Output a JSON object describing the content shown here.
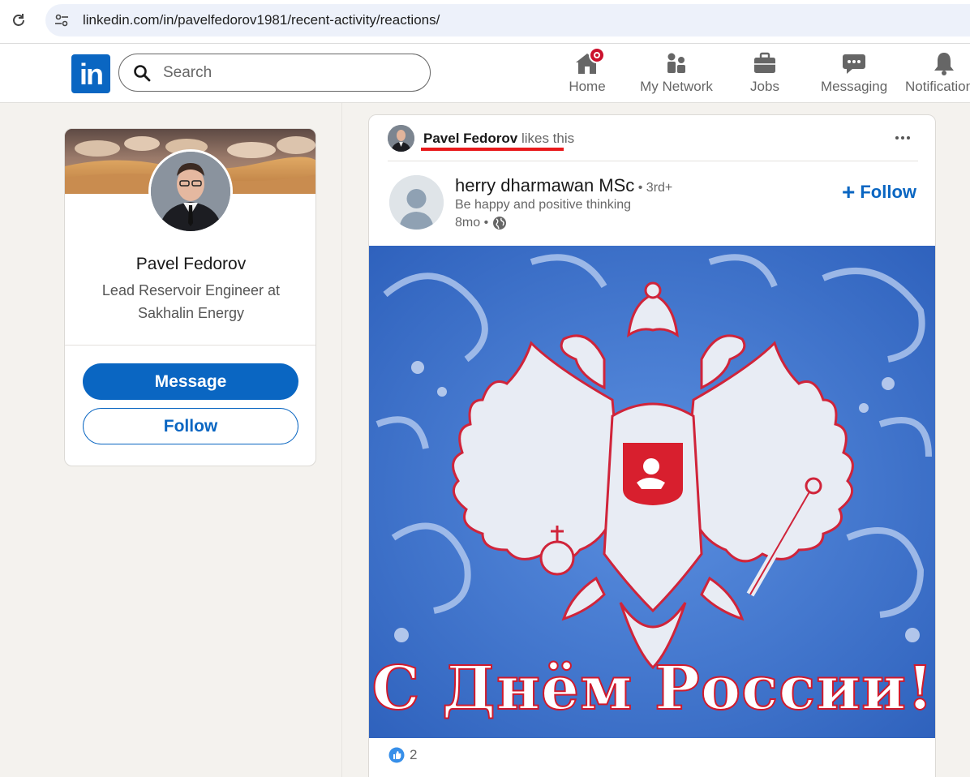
{
  "browser": {
    "url": "linkedin.com/in/pavelfedorov1981/recent-activity/reactions/"
  },
  "nav": {
    "logo": "in",
    "search_placeholder": "Search",
    "items": [
      {
        "label": "Home"
      },
      {
        "label": "My Network"
      },
      {
        "label": "Jobs"
      },
      {
        "label": "Messaging"
      },
      {
        "label": "Notifications"
      }
    ]
  },
  "profile": {
    "name": "Pavel Fedorov",
    "headline": "Lead Reservoir Engineer at Sakhalin Energy",
    "message_label": "Message",
    "follow_label": "Follow"
  },
  "post": {
    "context_name": "Pavel Fedorov",
    "context_action": " likes this",
    "author_name": "herry dharmawan MSc",
    "author_degree": " • 3rd+",
    "author_headline": "Be happy and positive thinking",
    "time": "8mo •",
    "follow_label": "Follow",
    "image_text": "С Днём России!",
    "reaction_count": "2"
  },
  "colors": {
    "brand": "#0a66c2",
    "notification_badge": "#cb112d",
    "highlight_underline": "#e8191b"
  }
}
